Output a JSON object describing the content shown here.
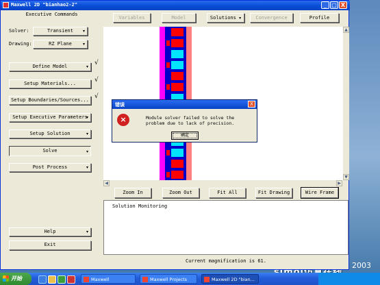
{
  "window": {
    "title": "Maxwell 2D \"bianhao2-2\"",
    "min": "_",
    "max": "□",
    "close": "X"
  },
  "left_panel": {
    "heading": "Executive Commands",
    "solver_label": "Solver:",
    "solver_value": "Transient",
    "drawing_label": "Drawing:",
    "drawing_value": "RZ Plane",
    "buttons": [
      {
        "label": "Define Model",
        "arrow": "▾",
        "checked": true
      },
      {
        "label": "Setup Materials...",
        "arrow": "",
        "checked": true
      },
      {
        "label": "Setup Boundaries/Sources...",
        "arrow": "",
        "checked": true
      },
      {
        "label": "Setup Executive Parameters",
        "arrow": "▾",
        "checked": false
      },
      {
        "label": "Setup Solution",
        "arrow": "▾",
        "checked": false
      },
      {
        "label": "Solve",
        "arrow": "▾",
        "checked": false
      },
      {
        "label": "Post Process",
        "arrow": "▾",
        "checked": false
      }
    ],
    "check_mark": "√",
    "help_label": "Help",
    "help_arrow": "▾",
    "exit_label": "Exit"
  },
  "toolbar": {
    "variables": "Variables",
    "model": "Model",
    "solutions": "Solutions",
    "solutions_arrow": "▾",
    "convergence": "Convergence",
    "profile": "Profile"
  },
  "view_controls": {
    "zoom_in": "Zoom In",
    "zoom_out": "Zoom Out",
    "fit_all": "Fit All",
    "fit_drawing": "Fit Drawing",
    "wire_frame": "Wire Frame"
  },
  "solution_monitoring": {
    "title": "Solution Monitoring"
  },
  "status_bar": {
    "text": "Current magnification is 61."
  },
  "dialog": {
    "title": "错误",
    "icon": "×",
    "message": "Module solver failed to solve the problem due to lack of precision.",
    "ok": "确定",
    "close": "X"
  },
  "taskbar": {
    "start": "开始",
    "items": [
      "Maxwell",
      "Maxwell Projects",
      "Maxwell 2D \"bian..."
    ]
  },
  "watermark": {
    "brand": "simol仿真在线",
    "year": "2003"
  },
  "colors": {
    "accent": "#0a4fd6",
    "error": "#d02020",
    "model_red": "#ff0000",
    "model_blue": "#0000c8",
    "model_cyan": "#00e5ff",
    "model_magenta": "#ff00ff",
    "model_pink": "#ff8080"
  }
}
